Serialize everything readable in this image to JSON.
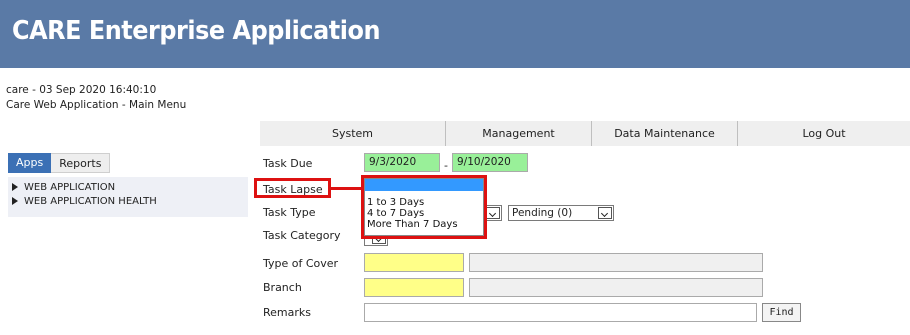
{
  "header": {
    "title": "CARE Enterprise Application"
  },
  "session": {
    "info": "care - 03 Sep 2020 16:40:10",
    "subtitle": "Care Web Application - Main Menu"
  },
  "menu": {
    "items": [
      {
        "label": "System"
      },
      {
        "label": "Management"
      },
      {
        "label": "Data Maintenance"
      },
      {
        "label": "Log Out"
      }
    ]
  },
  "sidebar": {
    "tabs": [
      {
        "label": "Apps",
        "active": true
      },
      {
        "label": "Reports",
        "active": false
      }
    ],
    "items": [
      {
        "label": "WEB APPLICATION"
      },
      {
        "label": "WEB APPLICATION HEALTH"
      }
    ]
  },
  "form": {
    "task_due": {
      "label": "Task Due",
      "from": "9/3/2020",
      "separator": "-",
      "to": "9/10/2020"
    },
    "task_lapse": {
      "label": "Task Lapse",
      "selected": "",
      "options": [
        "1 to 3 Days",
        "4 to 7 Days",
        "More Than 7 Days"
      ]
    },
    "task_type": {
      "label": "Task Type",
      "status_value": "Pending (0)"
    },
    "task_category": {
      "label": "Task Category"
    },
    "type_of_cover": {
      "label": "Type of Cover",
      "code": "",
      "description": ""
    },
    "branch": {
      "label": "Branch",
      "code": "",
      "description": ""
    },
    "remarks": {
      "label": "Remarks",
      "value": ""
    },
    "find_label": "Find"
  },
  "colors": {
    "banner": "#5a7aa6",
    "active_tab": "#3b70b5",
    "date_field": "#99f099",
    "required_field": "#ffff88",
    "highlight": "#dd1111",
    "dropdown_selection": "#3399ff"
  }
}
